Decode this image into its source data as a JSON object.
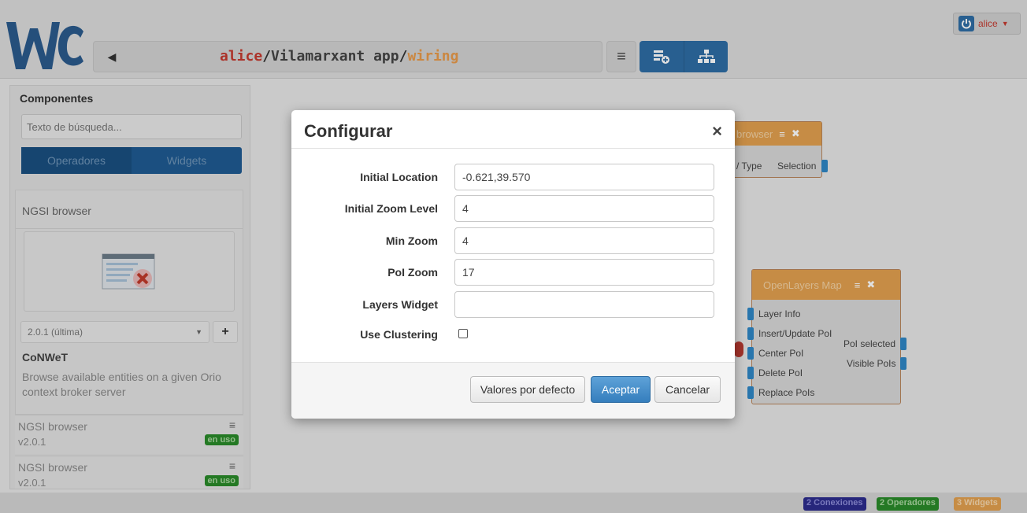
{
  "header": {
    "path_user": "alice",
    "path_sep1": "/",
    "path_workspace": "Vilamarxant app",
    "path_sep2": "/",
    "path_view": "wiring",
    "user_name": "alice"
  },
  "sidebar": {
    "title": "Componentes",
    "search_placeholder": "Texto de búsqueda...",
    "tabs": [
      "Operadores",
      "Widgets"
    ],
    "card": {
      "title": "NGSI browser",
      "version": "2.0.1 (última)",
      "vendor": "CoNWeT",
      "description": "Browse available entities on a given Orio context broker server"
    },
    "library_items": [
      {
        "name": "NGSI browser",
        "version": "v2.0.1",
        "badge": "en uso"
      },
      {
        "name": "NGSI browser",
        "version": "v2.0.1",
        "badge": "en uso"
      }
    ]
  },
  "canvas": {
    "browser_title": "browser",
    "browser_endpoints": [
      "/ Type",
      "Selection"
    ],
    "map_title": "OpenLayers Map",
    "map_inputs": [
      "Layer Info",
      "Insert/Update PoI",
      "Center PoI",
      "Delete PoI",
      "Replace PoIs"
    ],
    "map_outputs": [
      "PoI selected",
      "Visible PoIs"
    ]
  },
  "status": {
    "connections": "2 Conexiones",
    "operators": "2 Operadores",
    "widgets": "3 Widgets"
  },
  "modal": {
    "title": "Configurar",
    "close": "×",
    "fields": [
      {
        "label": "Initial Location",
        "value": "-0.621,39.570"
      },
      {
        "label": "Initial Zoom Level",
        "value": "4"
      },
      {
        "label": "Min Zoom",
        "value": "4"
      },
      {
        "label": "PoI Zoom",
        "value": "17"
      },
      {
        "label": "Layers Widget",
        "value": ""
      }
    ],
    "checkbox_label": "Use Clustering",
    "checkbox_checked": false,
    "buttons": {
      "defaults": "Valores por defecto",
      "accept": "Aceptar",
      "cancel": "Cancelar"
    }
  },
  "colors": {
    "primary": "#357ebd",
    "accent_orange": "#e2a04f",
    "badge_blue": "#2c2c8c",
    "badge_green": "#2a8a2a",
    "badge_orange": "#e2a04f"
  },
  "icons": {
    "back": "chevron-left-icon",
    "menu": "hamburger-icon",
    "add_component": "add-component-icon",
    "behaviour": "hierarchy-icon",
    "power": "power-icon",
    "close": "close-icon"
  }
}
